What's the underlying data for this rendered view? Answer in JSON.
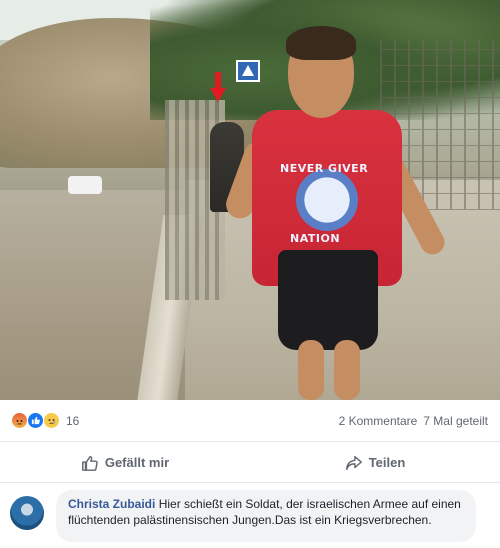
{
  "photo": {
    "shirt_text_top": "NEVER GIVER",
    "shirt_text_bottom": "NATION"
  },
  "reactions": {
    "icons": [
      "angry-icon",
      "like-icon",
      "sad-icon"
    ],
    "count": "16",
    "comments": "2 Kommentare",
    "shares": "7 Mal geteilt"
  },
  "actions": {
    "like_label": "Gefällt mir",
    "share_label": "Teilen"
  },
  "comment": {
    "author": "Christa Zubaidi",
    "text": "Hier schießt ein Soldat, der israelischen Armee auf einen flüchtenden palästinensischen Jungen.Das ist ein Kriegsverbrechen."
  },
  "colors": {
    "link": "#385898",
    "like_blue": "#1877f2",
    "shirt_red": "#d9323f"
  }
}
